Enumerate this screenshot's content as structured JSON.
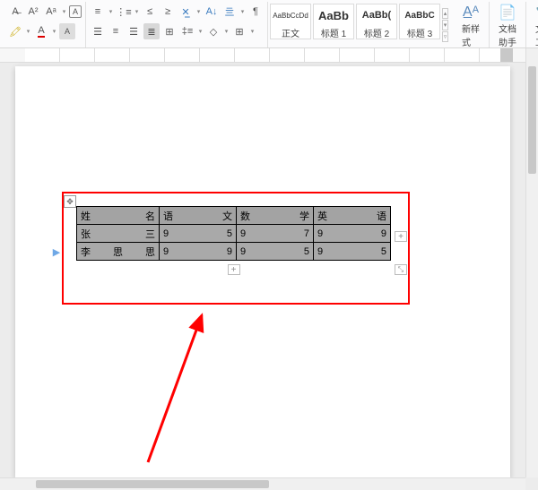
{
  "ribbon": {
    "styles": [
      {
        "preview": "AaBbCcDd",
        "label": "正文"
      },
      {
        "preview": "AaBb",
        "label": "标题 1"
      },
      {
        "preview": "AaBb(",
        "label": "标题 2"
      },
      {
        "preview": "AaBbC",
        "label": "标题 3"
      }
    ],
    "new_style": "新样式",
    "doc_assistant": "文档助手",
    "text_tools": "文字工具"
  },
  "table": {
    "headers": [
      {
        "left": "姓",
        "right": "名"
      },
      {
        "left": "语",
        "right": "文"
      },
      {
        "left": "数",
        "right": "学"
      },
      {
        "left": "英",
        "right": "语"
      }
    ],
    "rows": [
      {
        "name_left": "张",
        "name_right": "三",
        "c1l": "9",
        "c1r": "5",
        "c2l": "9",
        "c2r": "7",
        "c3l": "9",
        "c3r": "9"
      },
      {
        "name_left": "李",
        "name_mid": "思",
        "name_right": "思",
        "c1l": "9",
        "c1r": "9",
        "c2l": "9",
        "c2r": "5",
        "c3l": "9",
        "c3r": "5"
      }
    ]
  },
  "handles": {
    "plus": "+",
    "move": "✥",
    "resize": "⤡"
  }
}
